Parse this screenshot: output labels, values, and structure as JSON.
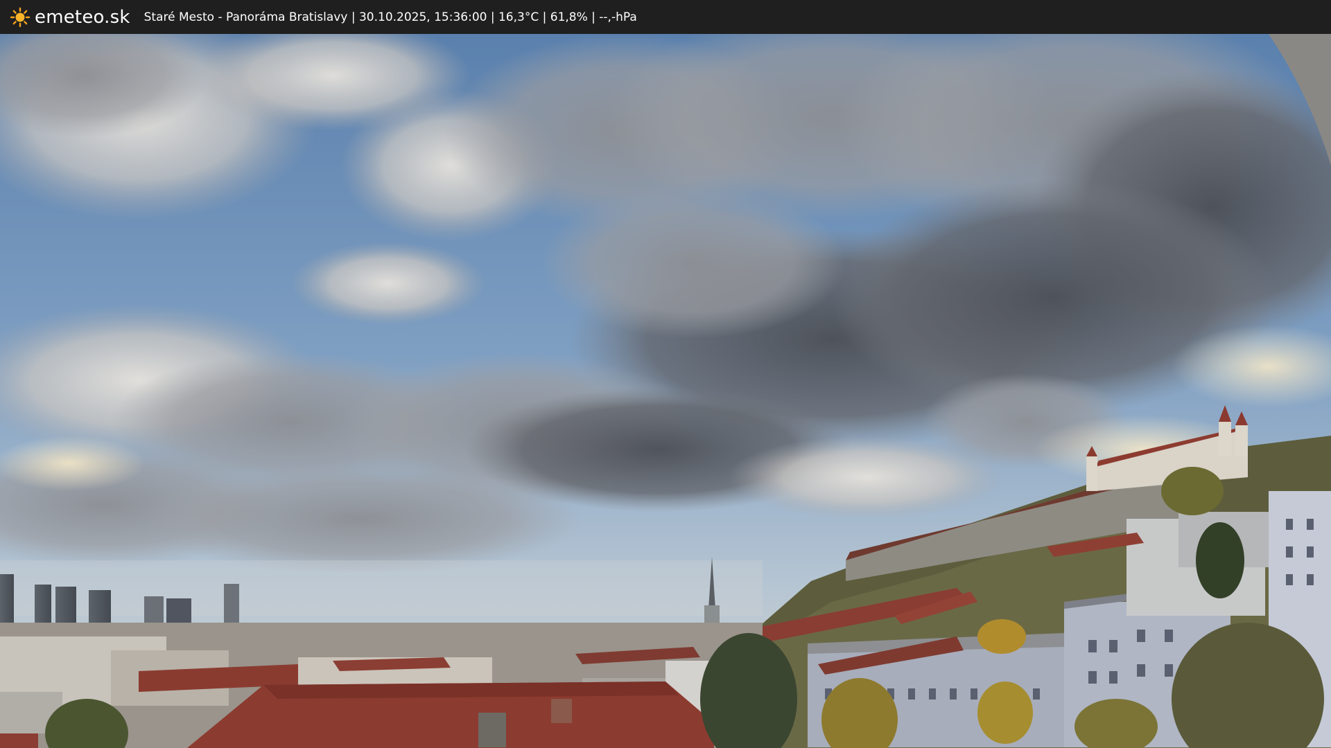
{
  "header": {
    "logo_text": "emeteo.sk",
    "logo_icon": "sun-icon",
    "caption": "Staré Mesto - Panoráma Bratislavy | 30.10.2025, 15:36:00 | 16,3°C | 61,8% | --,-hPa"
  },
  "webcam": {
    "scene": "city-panorama",
    "colors": {
      "sky_top": "#4f79a8",
      "sky_horizon": "#c9d3dc",
      "cloud_dark": "#55585e",
      "cloud_light": "#d9d6d1",
      "roof_red": "#8a3a2e",
      "castle_wall": "#8f8c84"
    }
  }
}
